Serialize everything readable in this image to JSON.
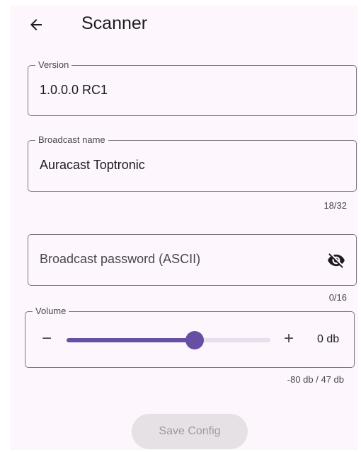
{
  "header": {
    "title": "Scanner",
    "back_icon": "arrow-left-icon"
  },
  "version_field": {
    "label": "Version",
    "value": "1.0.0.0 RC1"
  },
  "broadcast_name_field": {
    "label": "Broadcast name",
    "value": "Auracast Toptronic",
    "counter": "18/32"
  },
  "password_field": {
    "placeholder": "Broadcast password (ASCII)",
    "visibility_icon": "eye-off-icon",
    "counter": "0/16"
  },
  "volume_field": {
    "label": "Volume",
    "minus_label": "−",
    "plus_label": "+",
    "value_label": "0 db",
    "range_label": "-80 db / 47 db",
    "min": -80,
    "max": 47,
    "value": 0
  },
  "save_button": {
    "label": "Save Config",
    "enabled": false
  },
  "colors": {
    "background": "#fdf7fd",
    "accent": "#6750a4",
    "outline": "#79747e",
    "track_inactive": "#e7e0ec",
    "button_disabled_bg": "#e6e1e5",
    "button_disabled_text": "#9e9aa2"
  }
}
